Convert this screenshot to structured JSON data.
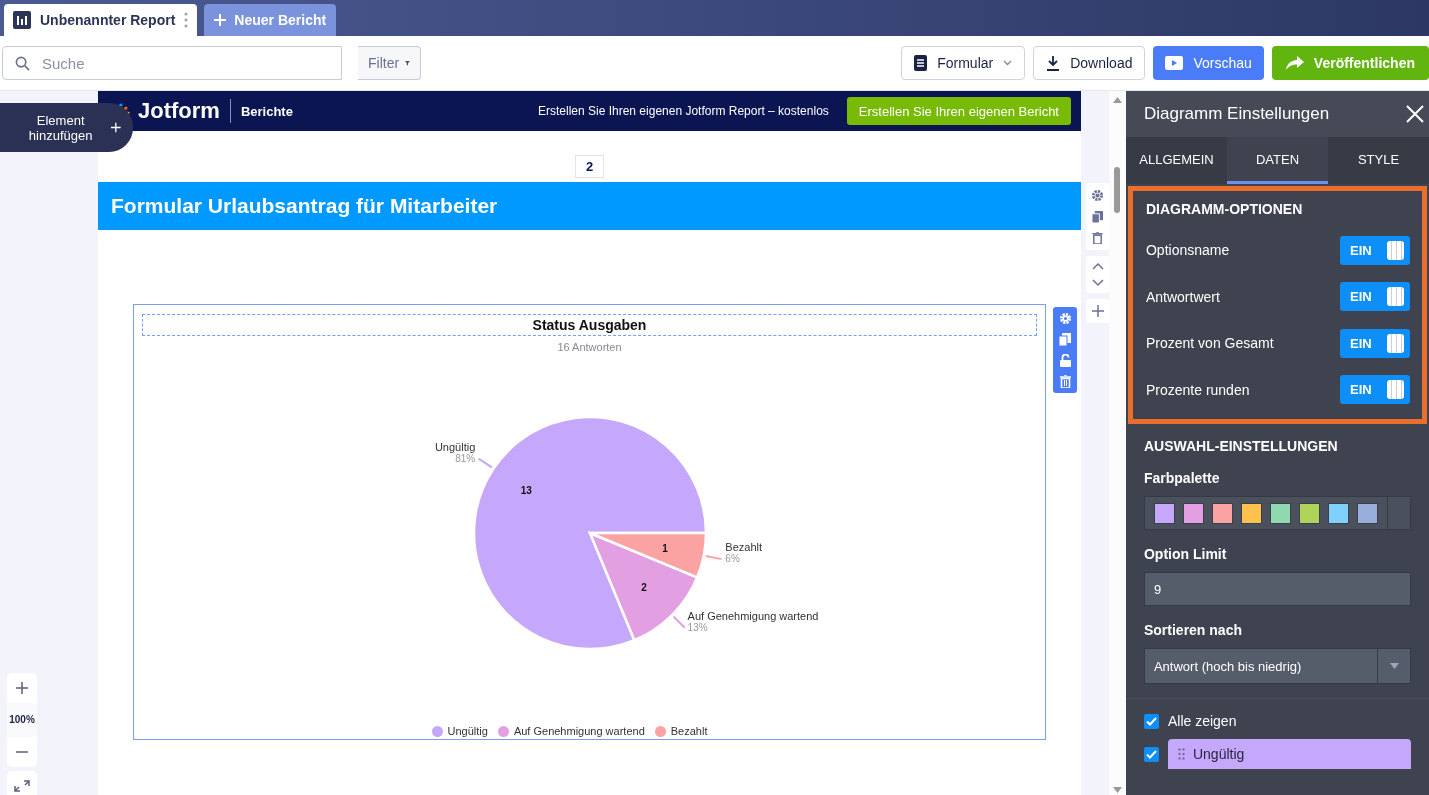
{
  "tabs": [
    {
      "label": "Unbenannter Report",
      "selected": true
    }
  ],
  "new_report_button": "Neuer Bericht",
  "search": {
    "placeholder": "Suche"
  },
  "filter_button": "Filter",
  "toolbar_buttons": [
    {
      "label": "Formular",
      "kind": "dropdown"
    },
    {
      "label": "Download",
      "kind": "download"
    },
    {
      "label": "Vorschau",
      "kind": "preview"
    },
    {
      "label": "Veröffentlichen",
      "kind": "publish"
    }
  ],
  "add_element_button": "Element hinzufügen",
  "zoom": {
    "level_text": "100%"
  },
  "report": {
    "brand": "Jotform",
    "section": "Berichte",
    "promo_text": "Erstellen Sie Ihren eigenen Jotform Report – kostenlos",
    "promo_button": "Erstellen Sie Ihren eigenen Bericht",
    "page_number": "2",
    "page_title": "Formular Urlaubsantrag für Mitarbeiter",
    "chart": {
      "subtitle": "16 Antworten",
      "percent_labels": [
        "81%",
        "13%",
        "6%"
      ],
      "chart_data": {
        "type": "pie",
        "title": "Status Ausgaben",
        "categories": [
          "Ungültig",
          "Auf Genehmigung wartend",
          "Bezahlt"
        ],
        "series": [
          {
            "values": [
              13,
              2,
              1
            ]
          }
        ],
        "data_labels": true
      }
    }
  },
  "settings": {
    "title": "Diagramm Einstellungen",
    "tabs": [
      {
        "label": "ALLGEMEIN",
        "selected": false
      },
      {
        "label": "DATEN",
        "selected": true
      },
      {
        "label": "STYLE",
        "selected": false
      }
    ],
    "options_heading": "DIAGRAMM-OPTIONEN",
    "options": [
      {
        "label": "Optionsname",
        "on": true,
        "state_label": "EIN"
      },
      {
        "label": "Antwortwert",
        "on": true,
        "state_label": "EIN"
      },
      {
        "label": "Prozent von Gesamt",
        "on": true,
        "state_label": "EIN"
      },
      {
        "label": "Prozente runden",
        "on": true,
        "state_label": "EIN"
      }
    ],
    "choice_heading": "AUSWAHL-EINSTELLUNGEN",
    "palette_label": "Farbpalette",
    "palette": [
      {
        "color": "#c5a8fb"
      },
      {
        "color": "#e2a0e2"
      },
      {
        "color": "#fba3a3"
      },
      {
        "color": "#fec14d"
      },
      {
        "color": "#8fd8b0"
      },
      {
        "color": "#afd35a"
      },
      {
        "color": "#7fd0fb"
      },
      {
        "color": "#9aaedb"
      }
    ],
    "limit_label": "Option Limit",
    "limit_value": "9",
    "sort_label": "Sortieren nach",
    "sort_value": "Antwort (hoch bis niedrig)",
    "show_all": {
      "label": "Alle zeigen",
      "checked": true
    },
    "choices": [
      {
        "label": "Ungültig",
        "checked": true,
        "color": "#c5a8fb"
      }
    ]
  }
}
